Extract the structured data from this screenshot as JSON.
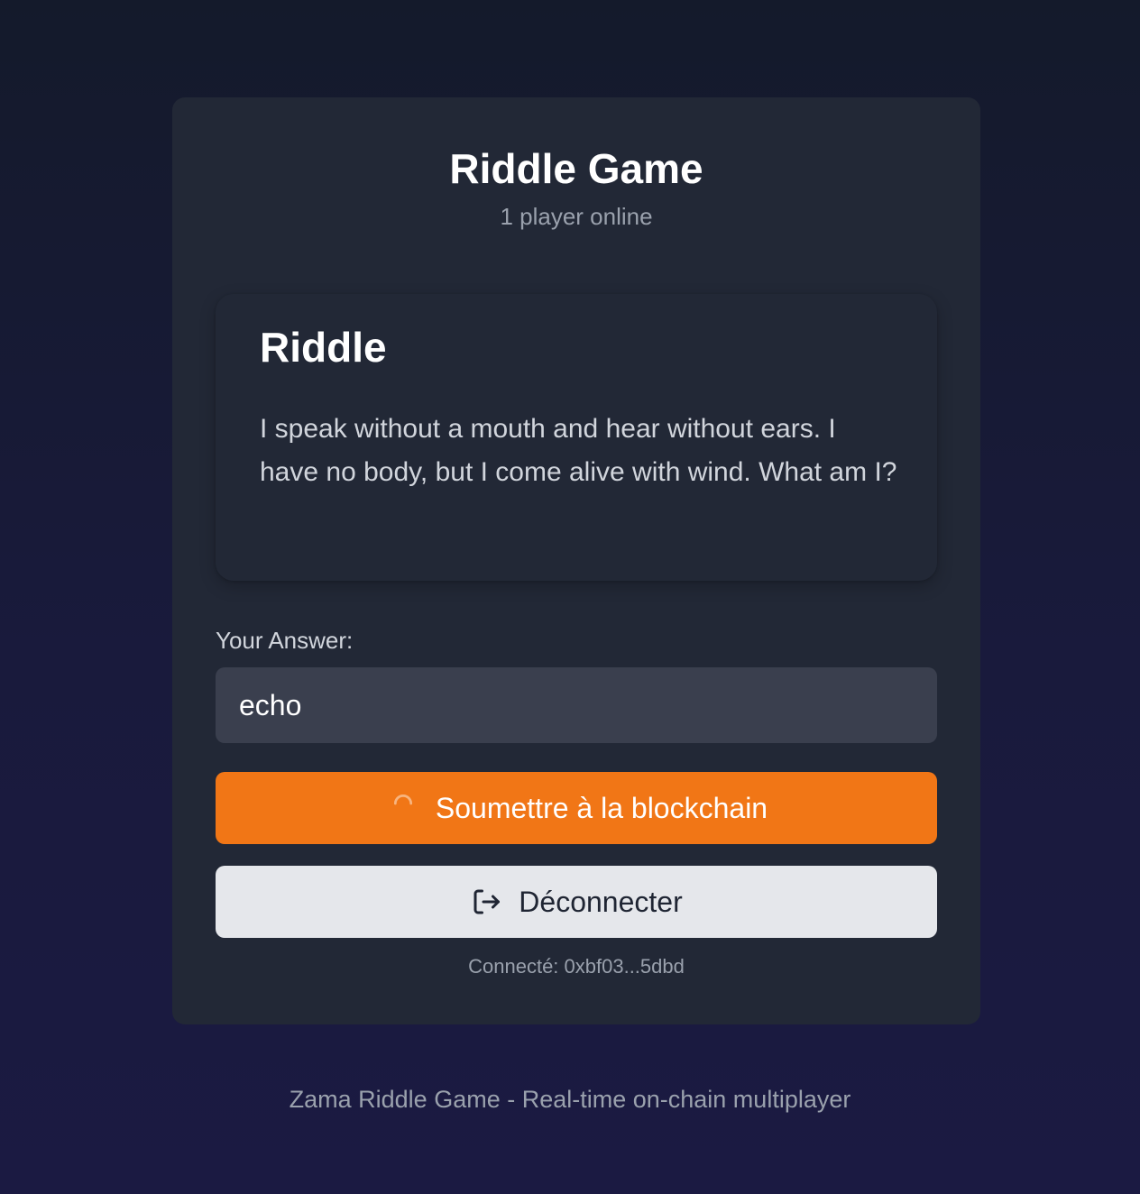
{
  "header": {
    "title": "Riddle Game",
    "players_online": "1 player online"
  },
  "riddle": {
    "heading": "Riddle",
    "text": "I speak without a mouth and hear without ears. I have no body, but I come alive with wind. What am I?"
  },
  "answer": {
    "label": "Your Answer:",
    "value": "echo",
    "placeholder": ""
  },
  "actions": {
    "submit_label": "Soumettre à la blockchain",
    "submit_icon": "spinner-icon",
    "disconnect_label": "Déconnecter",
    "disconnect_icon": "logout-icon"
  },
  "status": {
    "connected": "Connecté: 0xbf03...5dbd"
  },
  "footer": {
    "text": "Zama Riddle Game - Real-time on-chain multiplayer"
  },
  "colors": {
    "accent": "#f17616",
    "card_background": "#222836",
    "input_background": "#3a3f4e",
    "secondary_button": "#e5e7eb"
  }
}
